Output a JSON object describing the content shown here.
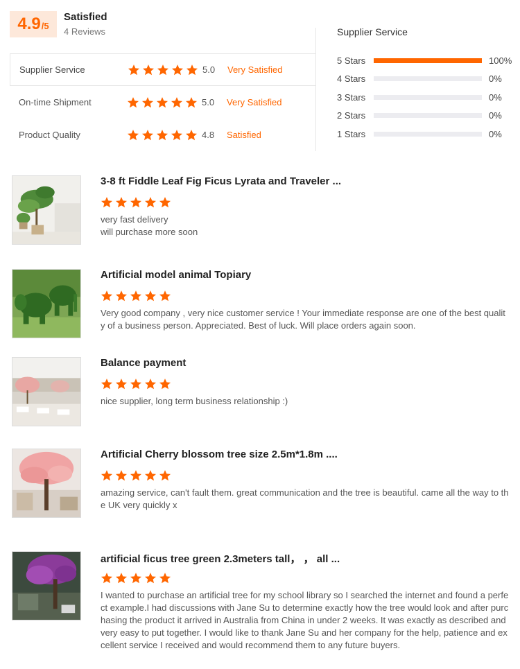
{
  "summary": {
    "score": "4.9",
    "score_denominator": "/5",
    "verdict": "Satisfied",
    "review_count": "4 Reviews",
    "categories": [
      {
        "label": "Supplier Service",
        "stars": 5,
        "score": "5.0",
        "verdict": "Very Satisfied"
      },
      {
        "label": "On-time Shipment",
        "stars": 5,
        "score": "5.0",
        "verdict": "Very Satisfied"
      },
      {
        "label": "Product Quality",
        "stars": 5,
        "score": "4.8",
        "verdict": "Satisfied"
      }
    ],
    "distribution": {
      "title": "Supplier Service",
      "rows": [
        {
          "label": "5 Stars",
          "fraction": 1.0,
          "pct": "100%"
        },
        {
          "label": "4 Stars",
          "fraction": 0.0,
          "pct": "0%"
        },
        {
          "label": "3 Stars",
          "fraction": 0.0,
          "pct": "0%"
        },
        {
          "label": "2 Stars",
          "fraction": 0.0,
          "pct": "0%"
        },
        {
          "label": "1 Stars",
          "fraction": 0.0,
          "pct": "0%"
        }
      ]
    }
  },
  "reviews": [
    {
      "title": "3-8 ft Fiddle Leaf Fig Ficus Lyrata and Traveler ...",
      "stars": 5,
      "text": "very fast delivery\nwill purchase more soon",
      "thumb_icon": "potted-plants-photo"
    },
    {
      "title": "Artificial model animal Topiary",
      "stars": 5,
      "text": "Very good company , very nice customer service ! Your immediate response are one of the best quality of a business person. Appreciated. Best of luck. Will place orders again soon.",
      "thumb_icon": "elephant-topiary-photo"
    },
    {
      "title": "Balance payment",
      "stars": 5,
      "text": "nice supplier, long term business relationship  :)",
      "thumb_icon": "banquet-hall-photo"
    },
    {
      "title": "Artificial Cherry blossom tree size 2.5m*1.8m ....",
      "stars": 5,
      "text": "amazing service, can't fault them. great communication and the tree is beautiful. came all the way to the UK very quickly x",
      "thumb_icon": "cherry-tree-photo"
    },
    {
      "title": "artificial ficus tree green 2.3meters tall， ， all ...",
      "stars": 5,
      "text": "I wanted to purchase an artificial tree for my school library so I searched the internet and found a perfect example.I had discussions with Jane Su to determine exactly how the tree would look and after purchasing the product it arrived in Australia from China in under 2 weeks. It was exactly as described and very easy to put together. I would like to thank Jane Su and her company for the help, patience and excellent service I received and would recommend them to any future buyers.",
      "thumb_icon": "purple-tree-photo"
    }
  ],
  "colors": {
    "accent": "#ff6600",
    "score_bg": "#fde8da",
    "track": "#ececf0"
  }
}
